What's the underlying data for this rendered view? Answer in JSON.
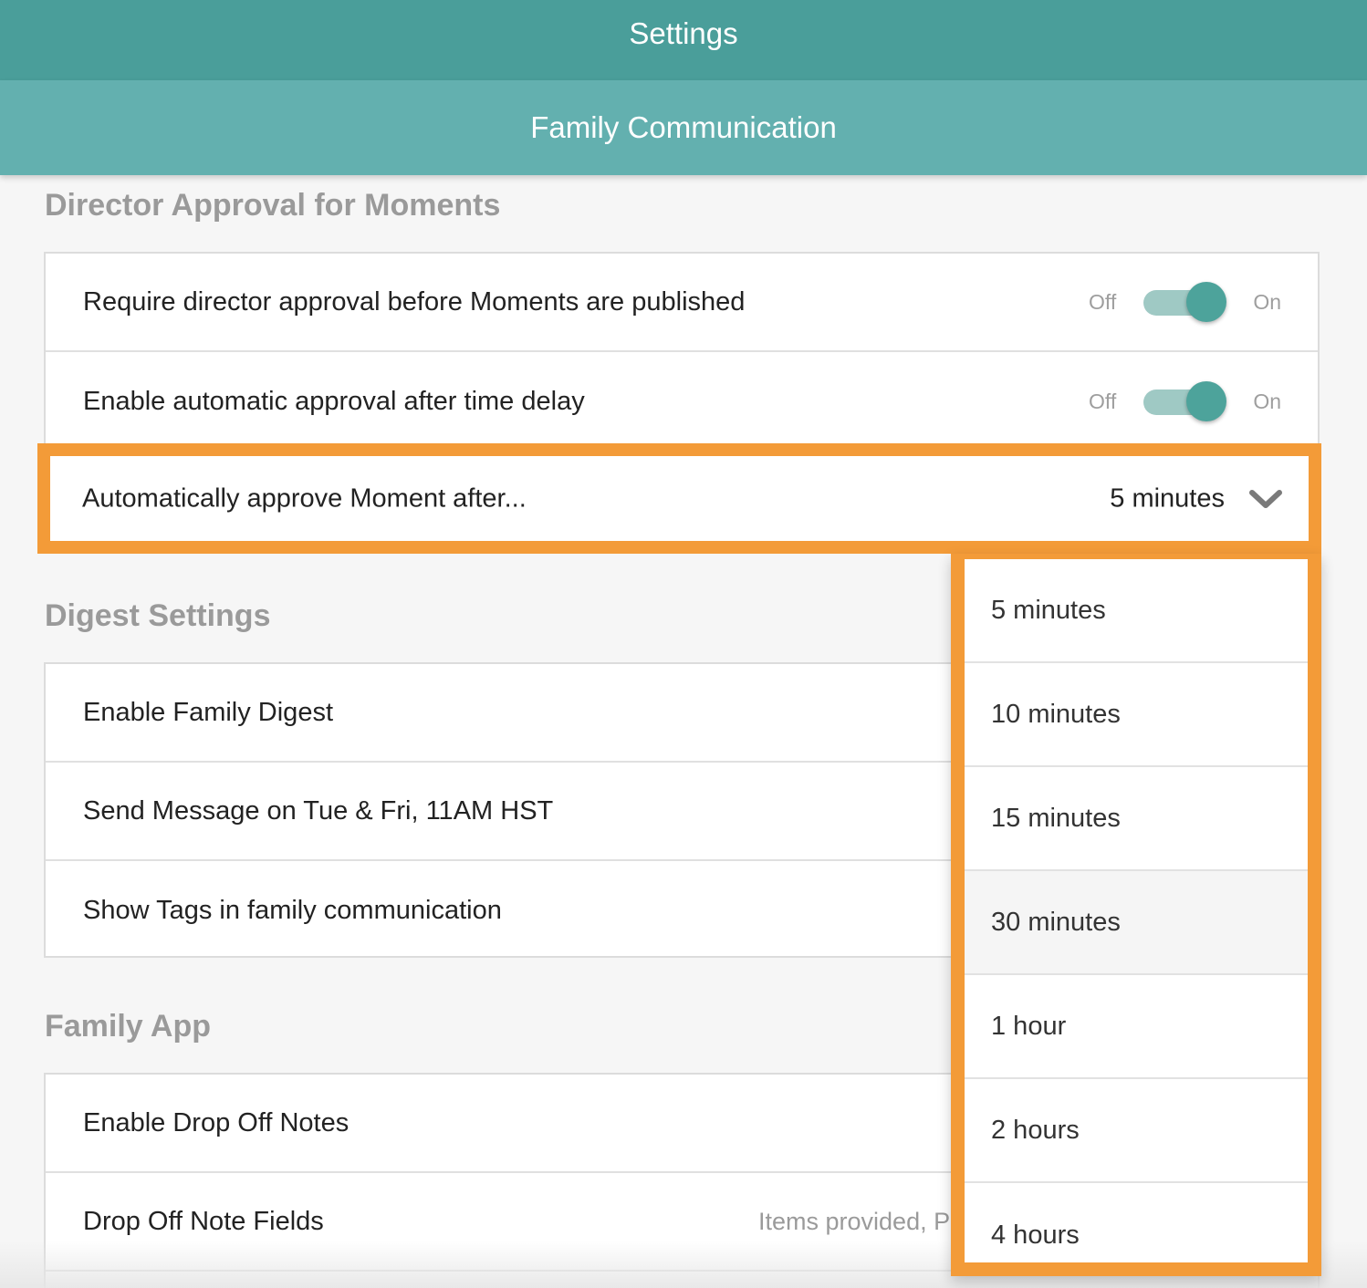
{
  "header": {
    "title": "Settings",
    "subtitle": "Family Communication"
  },
  "sections": {
    "director": {
      "title": "Director Approval for Moments",
      "rows": [
        {
          "label": "Require director approval before Moments are published",
          "off_label": "Off",
          "on_label": "On",
          "state": "on"
        },
        {
          "label": "Enable automatic approval after time delay",
          "off_label": "Off",
          "on_label": "On",
          "state": "on"
        },
        {
          "label": "Automatically approve Moment after...",
          "selected": "5 minutes"
        }
      ]
    },
    "digest": {
      "title": "Digest Settings",
      "rows": [
        {
          "label": "Enable Family Digest"
        },
        {
          "label": "Send Message on Tue & Fri, 11AM HST"
        },
        {
          "label": "Show Tags in family communication"
        }
      ]
    },
    "family_app": {
      "title": "Family App",
      "rows": [
        {
          "label": "Enable Drop Off Notes"
        },
        {
          "label": "Drop Off Note Fields",
          "value": "Items provided, P"
        }
      ]
    }
  },
  "dropdown": {
    "options": [
      "5 minutes",
      "10 minutes",
      "15 minutes",
      "30 minutes",
      "1 hour",
      "2 hours",
      "4 hours"
    ],
    "hovered": "30 minutes"
  },
  "colors": {
    "header_dark": "#4a9e9a",
    "header_light": "#63b0af",
    "highlight": "#f39b38",
    "toggle_knob": "#4da39b",
    "toggle_track": "#9fc9c4"
  }
}
